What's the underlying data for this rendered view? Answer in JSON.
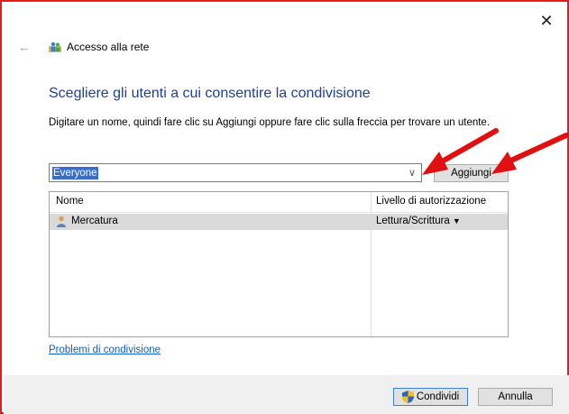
{
  "window": {
    "title": "Accesso alla rete",
    "close_glyph": "✕",
    "back_glyph": "←"
  },
  "main": {
    "heading": "Scegliere gli utenti a cui consentire la condivisione",
    "instruction": "Digitare un nome, quindi fare clic su Aggiungi oppure fare clic sulla freccia per trovare un utente.",
    "combo": {
      "value": "Everyone",
      "arrow_glyph": "∨"
    },
    "add_button": "Aggiungi",
    "table": {
      "columns": [
        "Nome",
        "Livello di autorizzazione"
      ],
      "rows": [
        {
          "name": "Mercatura",
          "permission": "Lettura/Scrittura",
          "dropdown_glyph": "▼"
        }
      ]
    },
    "help_link": "Problemi di condivisione"
  },
  "footer": {
    "share_button": "Condividi",
    "cancel_button": "Annulla"
  },
  "colors": {
    "frame_border": "#e81b1b",
    "heading": "#1f3f8f",
    "link": "#0a5ec5",
    "selection": "#3a6ecb",
    "annotation_arrow": "#e01010"
  },
  "icons": [
    "back-arrow-icon",
    "network-users-icon",
    "close-icon",
    "user-icon",
    "shield-icon",
    "red-arrow-annotation"
  ]
}
